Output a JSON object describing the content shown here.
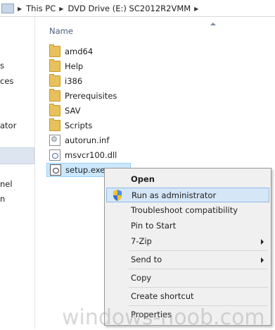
{
  "breadcrumb": {
    "items": [
      "This PC",
      "DVD Drive (E:) SC2012R2VMM"
    ]
  },
  "nav": {
    "items": [
      "s",
      "ces",
      "ator",
      "nel",
      "n"
    ]
  },
  "list": {
    "column_name": "Name",
    "files": [
      {
        "name": "amd64",
        "type": "folder"
      },
      {
        "name": "Help",
        "type": "folder"
      },
      {
        "name": "i386",
        "type": "folder"
      },
      {
        "name": "Prerequisites",
        "type": "folder"
      },
      {
        "name": "SAV",
        "type": "folder"
      },
      {
        "name": "Scripts",
        "type": "folder"
      },
      {
        "name": "autorun.inf",
        "type": "inf"
      },
      {
        "name": "msvcr100.dll",
        "type": "dll"
      },
      {
        "name": "setup.exe",
        "type": "exe",
        "selected": true
      }
    ]
  },
  "context_menu": {
    "items": [
      {
        "label": "Open",
        "bold": true
      },
      {
        "label": "Run as administrator",
        "icon": "shield-icon",
        "hover": true
      },
      {
        "label": "Troubleshoot compatibility"
      },
      {
        "label": "Pin to Start"
      },
      {
        "label": "7-Zip",
        "submenu": true
      },
      {
        "label": "Send to",
        "submenu": true
      },
      {
        "label": "Copy"
      },
      {
        "label": "Create shortcut"
      },
      {
        "label": "Properties"
      }
    ]
  },
  "watermark": "windows-noob.com",
  "colors": {
    "selection": "#cce8ff",
    "menu_hover": "#d5e6f6",
    "folder": "#e8c15a"
  }
}
